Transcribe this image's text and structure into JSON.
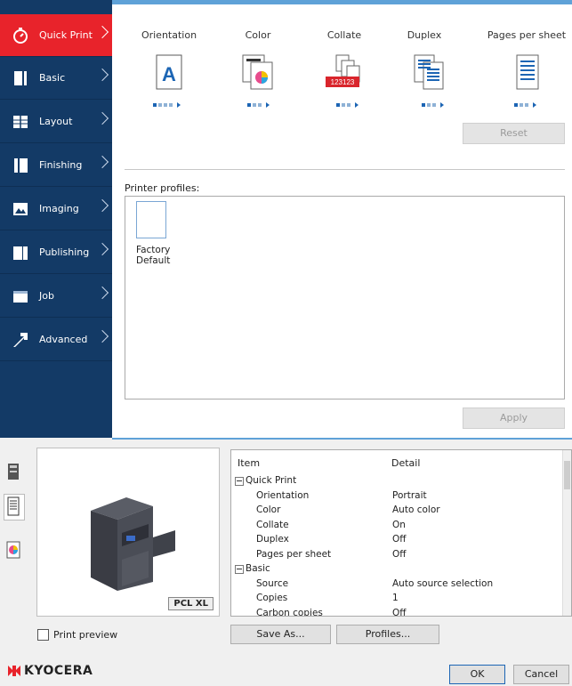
{
  "sidebar": {
    "items": [
      {
        "label": "Quick Print",
        "icon": "stopwatch-icon"
      },
      {
        "label": "Basic",
        "icon": "basic-page-icon"
      },
      {
        "label": "Layout",
        "icon": "layout-grid-icon"
      },
      {
        "label": "Finishing",
        "icon": "finishing-icon"
      },
      {
        "label": "Imaging",
        "icon": "imaging-icon"
      },
      {
        "label": "Publishing",
        "icon": "publishing-icon"
      },
      {
        "label": "Job",
        "icon": "job-icon"
      },
      {
        "label": "Advanced",
        "icon": "advanced-arrow-icon"
      }
    ]
  },
  "quick_print": {
    "columns": [
      "Orientation",
      "Color",
      "Collate",
      "Duplex",
      "Pages per sheet"
    ],
    "reset_label": "Reset",
    "orientation_letter": "A",
    "collate_numbers": "123123"
  },
  "profiles": {
    "label": "Printer profiles:",
    "items": [
      {
        "name": "Factory Default"
      }
    ],
    "apply_label": "Apply"
  },
  "preview": {
    "pdl_label": "PCL XL",
    "print_preview_label": "Print preview"
  },
  "table": {
    "headers": [
      "Item",
      "Detail"
    ],
    "rows": [
      {
        "item": "Quick Print",
        "detail": "",
        "group": true
      },
      {
        "item": "Orientation",
        "detail": "Portrait",
        "group": false
      },
      {
        "item": "Color",
        "detail": "Auto color",
        "group": false
      },
      {
        "item": "Collate",
        "detail": "On",
        "group": false
      },
      {
        "item": "Duplex",
        "detail": "Off",
        "group": false
      },
      {
        "item": "Pages per sheet",
        "detail": "Off",
        "group": false
      },
      {
        "item": "Basic",
        "detail": "",
        "group": true
      },
      {
        "item": "Source",
        "detail": "Auto source selection",
        "group": false
      },
      {
        "item": "Copies",
        "detail": "1",
        "group": false
      },
      {
        "item": "Carbon copies",
        "detail": "Off",
        "group": false
      }
    ]
  },
  "footer": {
    "brand": "KYOCERA",
    "save_as_label": "Save As...",
    "profiles_label": "Profiles...",
    "ok_label": "OK",
    "cancel_label": "Cancel"
  },
  "colors": {
    "accent": "#e8232b",
    "sidebar": "#133a66",
    "highlight": "#1c65b4"
  }
}
